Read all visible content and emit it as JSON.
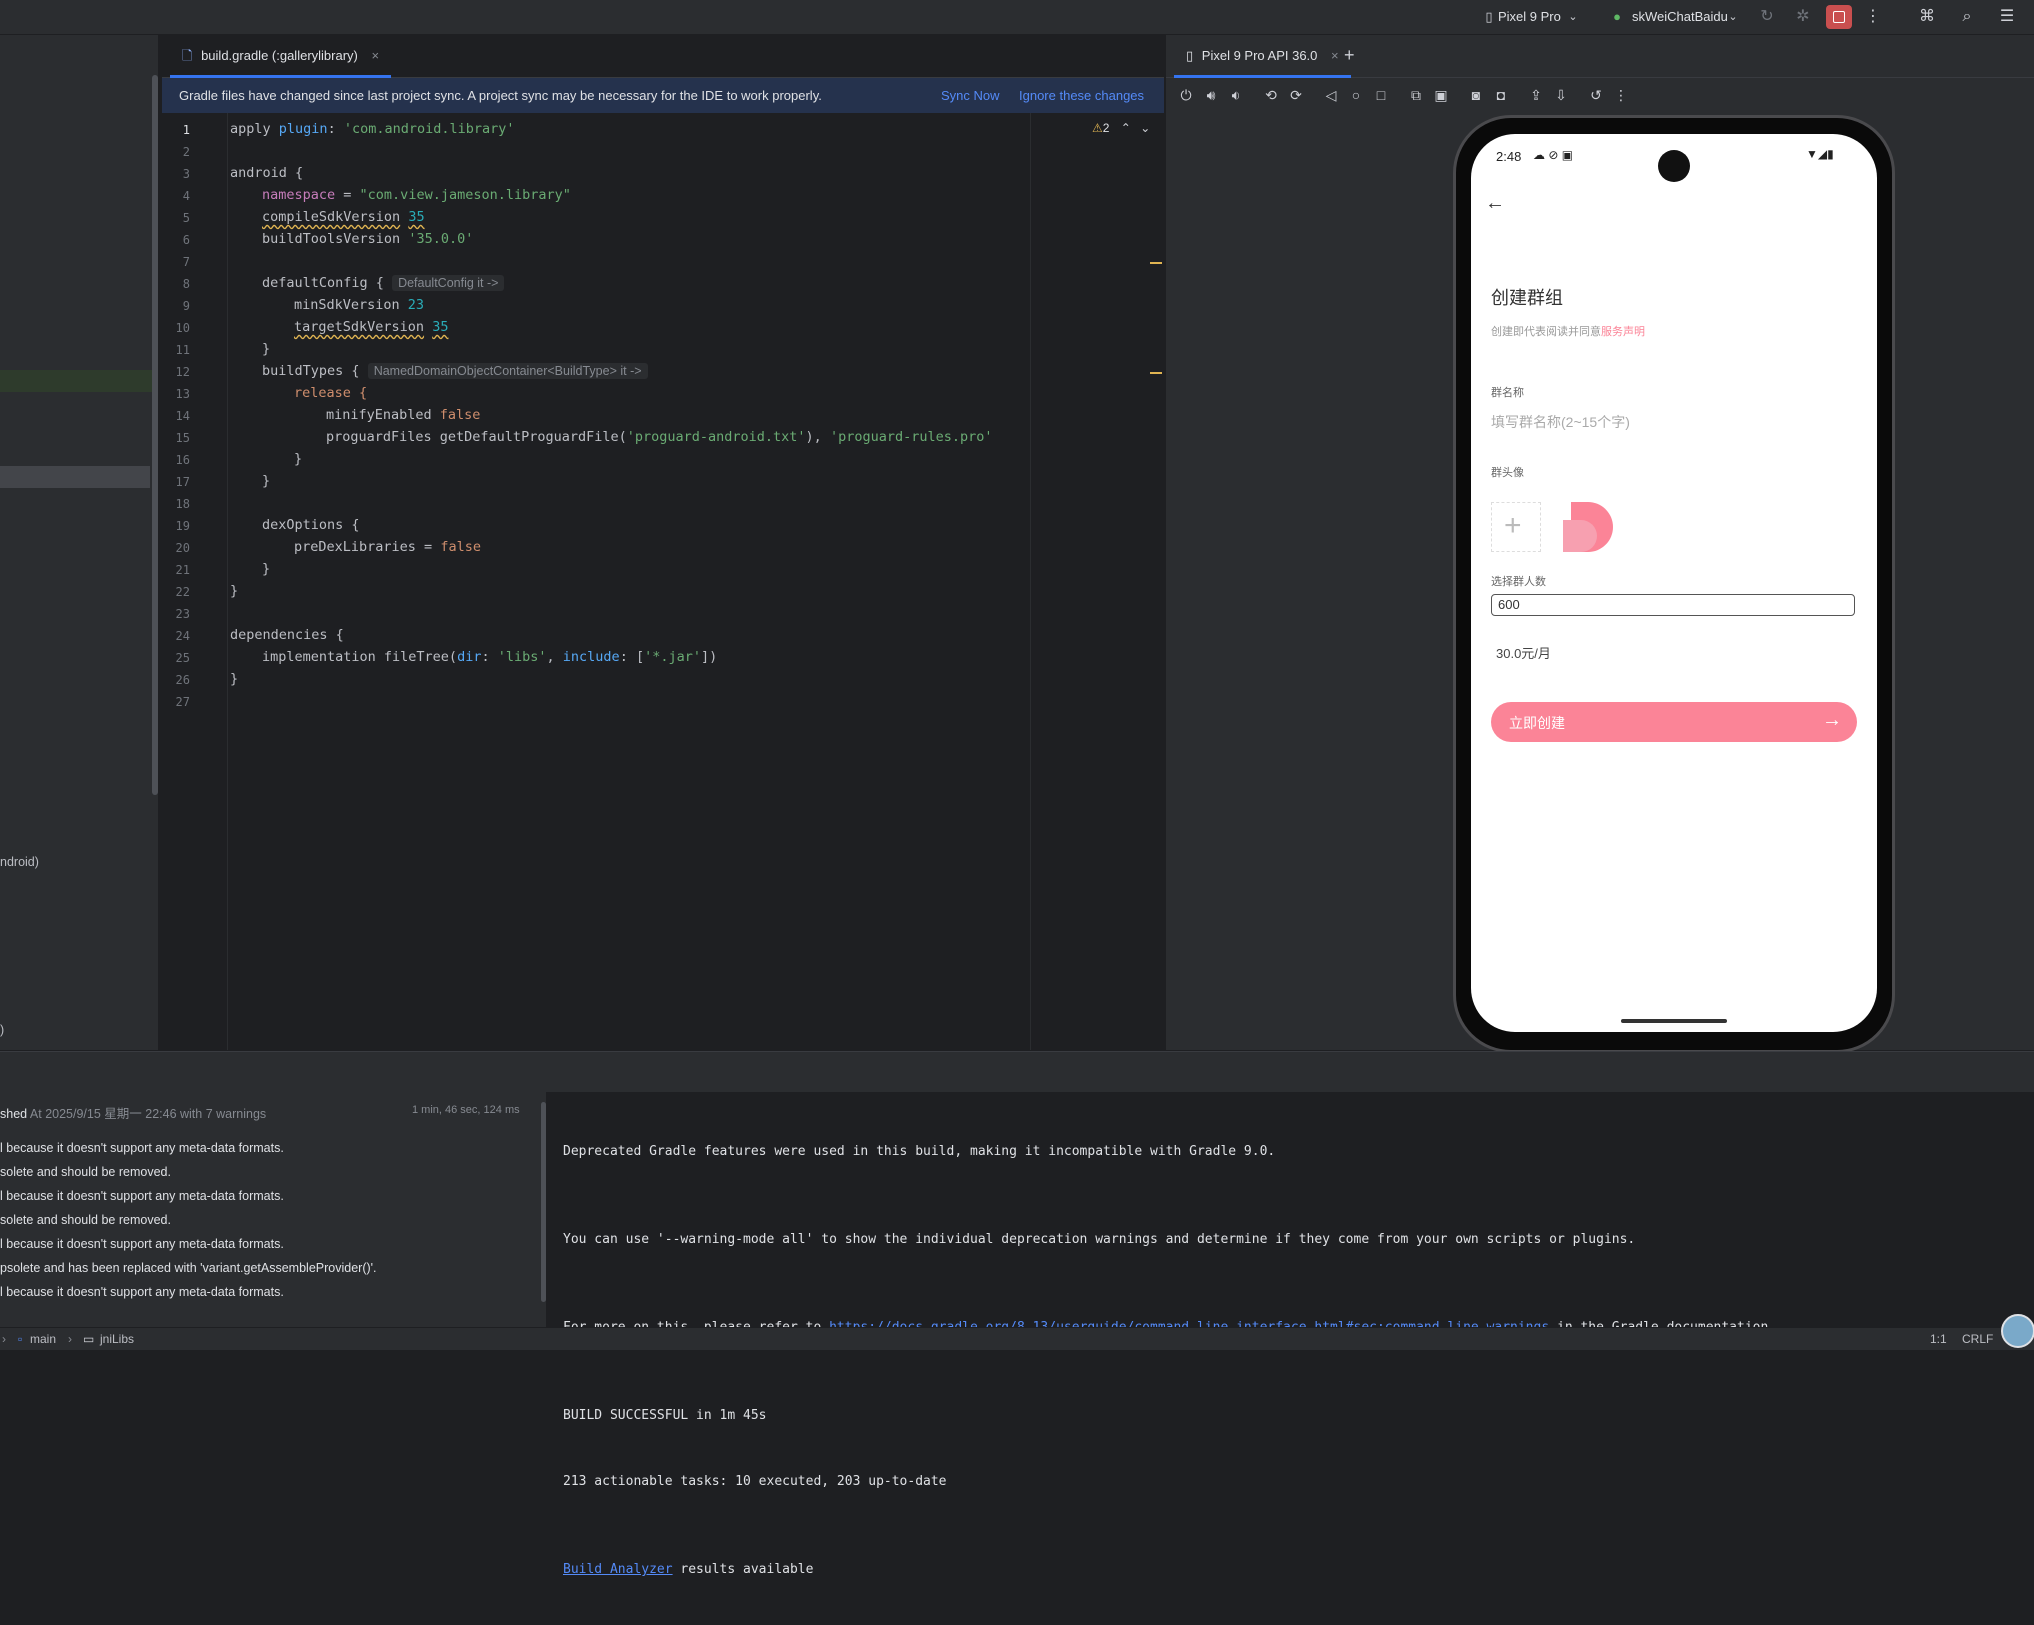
{
  "toolbar": {
    "device": "Pixel 9 Pro",
    "run_config": "skWeiChatBaidu"
  },
  "editor": {
    "tab_label": "build.gradle (:gallerylibrary)",
    "banner": {
      "message": "Gradle files have changed since last project sync. A project sync may be necessary for the IDE to work properly.",
      "sync_now": "Sync Now",
      "ignore": "Ignore these changes"
    },
    "warnings_count": "2",
    "hints": {
      "default_config": "DefaultConfig it ->",
      "build_types": "NamedDomainObjectContainer<BuildType> it ->"
    },
    "code": {
      "l1_apply": "apply ",
      "l1_plugin": "plugin",
      "l1_colon": ": ",
      "l1_value": "'com.android.library'",
      "l3": "android {",
      "l4_key": "namespace",
      "l4_eq": " = ",
      "l4_value": "\"com.view.jameson.library\"",
      "l5_key": "compileSdkVersion",
      "l5_value": "35",
      "l6_key": "buildToolsVersion ",
      "l6_value": "'35.0.0'",
      "l8": "defaultConfig {",
      "l9_key": "minSdkVersion ",
      "l9_value": "23",
      "l10_key": "targetSdkVersion",
      "l10_value": "35",
      "l11": "}",
      "l12": "buildTypes {",
      "l13": "release {",
      "l14_key": "minifyEnabled ",
      "l14_value": "false",
      "l15_fn": "proguardFiles getDefaultProguardFile(",
      "l15_arg1": "'proguard-android.txt'",
      "l15_sep": "), ",
      "l15_arg2": "'proguard-rules.pro'",
      "l16": "}",
      "l17": "}",
      "l19": "dexOptions {",
      "l20_key": "preDexLibraries = ",
      "l20_value": "false",
      "l21": "}",
      "l22": "}",
      "l24": "dependencies {",
      "l25_fn": "implementation fileTree(",
      "l25_dir": "dir",
      "l25_colon1": ": ",
      "l25_libs": "'libs'",
      "l25_comma": ", ",
      "l25_include": "include",
      "l25_colon2": ": [",
      "l25_jar": "'*.jar'",
      "l25_end": "])",
      "l26": "}"
    }
  },
  "left_panel": {
    "frag1": "ndroid)",
    "frag2": ")"
  },
  "emulator": {
    "tab_label": "Pixel 9 Pro API 36.0",
    "phone": {
      "time": "2:48",
      "title": "创建群组",
      "disclaimer_prefix": "创建即代表阅读并同意",
      "disclaimer_link": "服务声明",
      "name_label": "群名称",
      "name_placeholder": "填写群名称(2~15个字)",
      "avatar_label": "群头像",
      "count_label": "选择群人数",
      "count_value": "600",
      "price": "30.0元/月",
      "create_button": "立即创建"
    }
  },
  "build": {
    "header_prefix": "shed",
    "header_time": "At 2025/9/15 星期一 22:46 with 7 warnings",
    "duration": "1 min, 46 sec, 124 ms",
    "messages": [
      "l because it doesn't support any meta-data formats.",
      "solete and should be removed.",
      "l because it doesn't support any meta-data formats.",
      "solete and should be removed.",
      "l because it doesn't support any meta-data formats.",
      "psolete and has been replaced with 'variant.getAssembleProvider()'.",
      "l because it doesn't support any meta-data formats."
    ],
    "console": {
      "line1": "Deprecated Gradle features were used in this build, making it incompatible with Gradle 9.0.",
      "line2": "You can use '--warning-mode all' to show the individual deprecation warnings and determine if they come from your own scripts or plugins.",
      "line3_prefix": "For more on this, please refer to ",
      "line3_link": "https://docs.gradle.org/8.13/userguide/command_line_interface.html#sec:command_line_warnings",
      "line3_suffix": " in the Gradle documentation.",
      "line4": "BUILD SUCCESSFUL in 1m 45s",
      "line5": "213 actionable tasks: 10 executed, 203 up-to-date",
      "line6_link": "Build Analyzer",
      "line6_suffix": " results available"
    }
  },
  "statusbar": {
    "crumb_main": "main",
    "crumb_jnilibs": "jniLibs",
    "position": "1:1",
    "line_sep": "CRLF"
  },
  "colors": {
    "accent": "#3574f0",
    "pink": "#fb8497",
    "pink_light": "#f7a0b0"
  }
}
